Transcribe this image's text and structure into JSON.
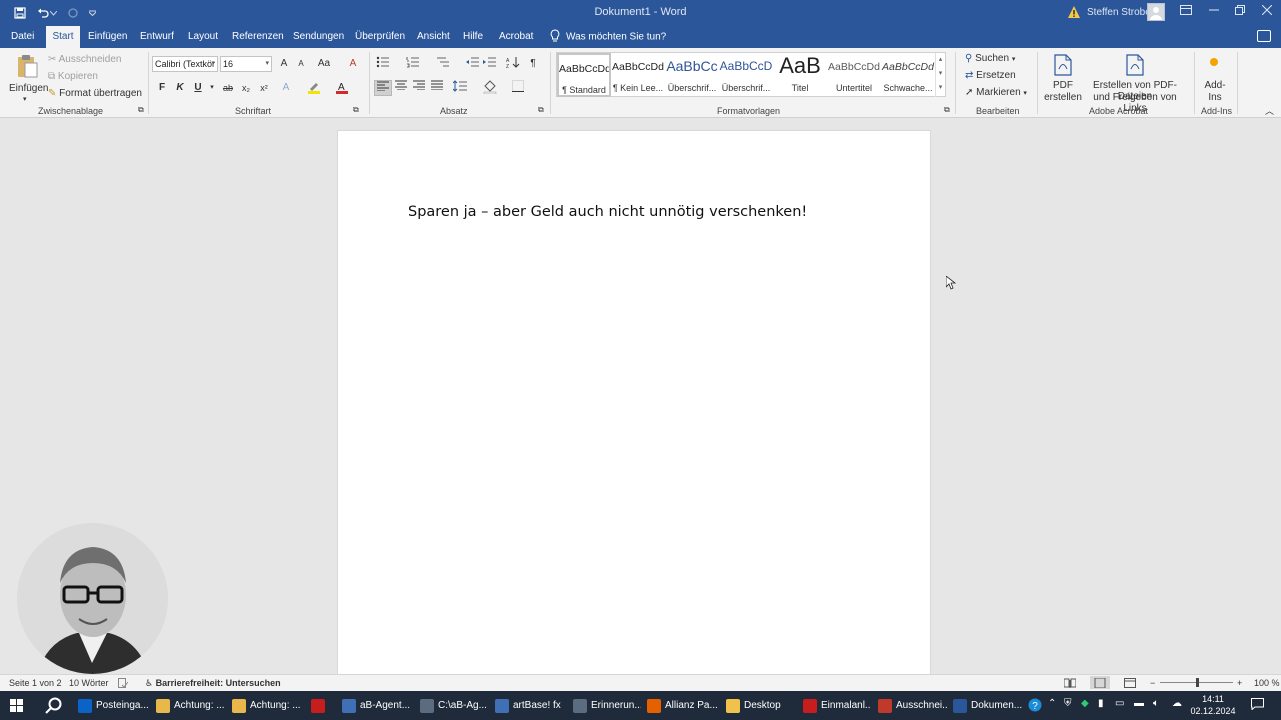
{
  "titlebar": {
    "doc_title": "Dokument1  -  Word",
    "user_name": "Steffen Strobel",
    "save_icon": "save-icon",
    "undo_icon": "undo-icon",
    "redo_icon": "redo-icon",
    "customize_icon": "chevron-down-icon",
    "warning_icon": "warning-icon",
    "ribbon_options_icon": "ribbon-display-icon",
    "minimize_icon": "minimize-icon",
    "maximize_icon": "restore-icon",
    "close_icon": "close-icon",
    "accent_color": "#2b579a"
  },
  "menu": {
    "tabs": [
      "Datei",
      "Start",
      "Einfügen",
      "Entwurf",
      "Layout",
      "Referenzen",
      "Sendungen",
      "Überprüfen",
      "Ansicht",
      "Hilfe",
      "Acrobat"
    ],
    "active": "Start",
    "tell_me": "Was möchten Sie tun?"
  },
  "ribbon": {
    "clipboard": {
      "paste": "Einfügen",
      "cut": "Ausschneiden",
      "copy": "Kopieren",
      "format_painter": "Format übertragen",
      "label": "Zwischenablage"
    },
    "font": {
      "font_name": "Calibri (Textkör",
      "font_size": "16",
      "bold": "F",
      "italic": "K",
      "underline": "U",
      "strike": "ab",
      "subscript": "x₂",
      "superscript": "x²",
      "grow": "A",
      "shrink": "A",
      "case": "Aa",
      "clear": "A",
      "label": "Schriftart"
    },
    "paragraph": {
      "label": "Absatz",
      "pilcrow": "¶"
    },
    "styles": {
      "label": "Formatvorlagen",
      "items": [
        {
          "sample": "AaBbCcDd",
          "name": "¶ Standard"
        },
        {
          "sample": "AaBbCcDd",
          "name": "¶ Kein Lee..."
        },
        {
          "sample": "AaBbCc",
          "name": "Überschrif..."
        },
        {
          "sample": "AaBbCcD",
          "name": "Überschrif..."
        },
        {
          "sample": "AaB",
          "name": "Titel"
        },
        {
          "sample": "AaBbCcDd",
          "name": "Untertitel"
        },
        {
          "sample": "AaBbCcDd",
          "name": "Schwache..."
        }
      ]
    },
    "editing": {
      "find": "Suchen",
      "replace": "Ersetzen",
      "select": "Markieren",
      "label": "Bearbeiten"
    },
    "acrobat": {
      "create_pdf_1": "PDF",
      "create_pdf_2": "erstellen",
      "share_1": "Erstellen von PDF-Dateien",
      "share_2": "und Freigeben von Links",
      "label": "Adobe Acrobat"
    },
    "addins": {
      "btn_1": "Add-",
      "btn_2": "Ins",
      "label": "Add-Ins"
    }
  },
  "document": {
    "text": "Sparen ja – aber Geld auch nicht unnötig verschenken!"
  },
  "status": {
    "page": "Seite 1 von 2",
    "words": "10 Wörter",
    "accessibility": "Barrierefreiheit: Untersuchen",
    "zoom": "100 %",
    "zoom_value": 100
  },
  "taskbar": {
    "items": [
      {
        "label": "Posteinga...",
        "icon": "outlook-icon",
        "color": "#0a64c8"
      },
      {
        "label": "Achtung: ...",
        "icon": "mail-icon",
        "color": "#e8b94a"
      },
      {
        "label": "Achtung: ...",
        "icon": "mail-icon",
        "color": "#e8b94a"
      },
      {
        "label": "",
        "icon": "pdf-app-icon",
        "color": "#c81d1d"
      },
      {
        "label": "aB-Agent...",
        "icon": "app-window-icon",
        "color": "#3f6fb5"
      },
      {
        "label": "C:\\aB-Ag...",
        "icon": "cursor-app-icon",
        "color": "#5b6b80"
      },
      {
        "label": "artBase! fx",
        "icon": "app-window-icon",
        "color": "#3f6fb5"
      },
      {
        "label": "Erinnerun...",
        "icon": "reminder-icon",
        "color": "#5b6b80"
      },
      {
        "label": "Allianz Pa...",
        "icon": "firefox-icon",
        "color": "#e66000"
      },
      {
        "label": "Desktop",
        "icon": "folder-icon",
        "color": "#f0c24b"
      },
      {
        "label": "Einmalanl...",
        "icon": "pdf-icon",
        "color": "#c81d1d"
      },
      {
        "label": "Ausschnei...",
        "icon": "snipping-icon",
        "color": "#c0392b"
      },
      {
        "label": "Dokumen...",
        "icon": "word-icon",
        "color": "#2b579a"
      }
    ],
    "time": "14:11",
    "date": "02.12.2024"
  }
}
